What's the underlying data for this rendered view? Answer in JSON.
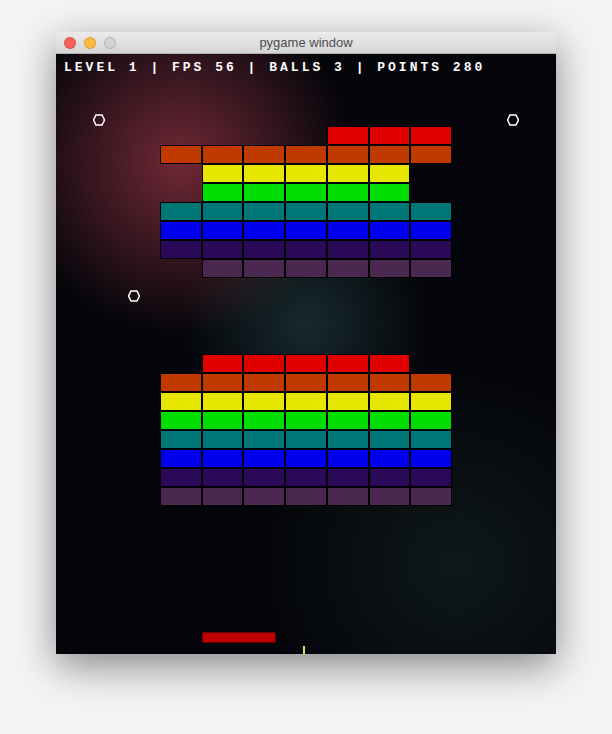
{
  "window": {
    "title": "pygame window",
    "buttons": [
      {
        "name": "close",
        "color": "#fc605c"
      },
      {
        "name": "minimize",
        "color": "#fdbc40"
      },
      {
        "name": "zoom",
        "color": "#d2d2d2"
      }
    ]
  },
  "hud": {
    "text": "LEVEL 1 | FPS 56 | BALLS 3 | POINTS 280"
  },
  "walls": [
    {
      "rows": [
        {
          "color": "#e00000",
          "cells": [
            false,
            false,
            false,
            false,
            true,
            true,
            true
          ]
        },
        {
          "color": "#c03a00",
          "cells": [
            true,
            true,
            true,
            true,
            true,
            true,
            true
          ]
        },
        {
          "color": "#e6e600",
          "cells": [
            false,
            true,
            true,
            true,
            true,
            true,
            false
          ]
        },
        {
          "color": "#00dd00",
          "cells": [
            false,
            true,
            true,
            true,
            true,
            true,
            false
          ]
        },
        {
          "color": "#007777",
          "cells": [
            true,
            true,
            true,
            true,
            true,
            true,
            true
          ]
        },
        {
          "color": "#0000ee",
          "cells": [
            true,
            true,
            true,
            true,
            true,
            true,
            true
          ]
        },
        {
          "color": "#2a0a58",
          "cells": [
            true,
            true,
            true,
            true,
            true,
            true,
            true
          ]
        },
        {
          "color": "#4a2850",
          "cells": [
            false,
            true,
            true,
            true,
            true,
            true,
            true
          ]
        }
      ]
    },
    {
      "rows": [
        {
          "color": "#e00000",
          "cells": [
            false,
            true,
            true,
            true,
            true,
            true,
            false
          ]
        },
        {
          "color": "#c03a00",
          "cells": [
            true,
            true,
            true,
            true,
            true,
            true,
            true
          ]
        },
        {
          "color": "#e6e600",
          "cells": [
            true,
            true,
            true,
            true,
            true,
            true,
            true
          ]
        },
        {
          "color": "#00dd00",
          "cells": [
            true,
            true,
            true,
            true,
            true,
            true,
            true
          ]
        },
        {
          "color": "#007777",
          "cells": [
            true,
            true,
            true,
            true,
            true,
            true,
            true
          ]
        },
        {
          "color": "#0000ee",
          "cells": [
            true,
            true,
            true,
            true,
            true,
            true,
            true
          ]
        },
        {
          "color": "#2a0a58",
          "cells": [
            true,
            true,
            true,
            true,
            true,
            true,
            true
          ]
        },
        {
          "color": "#4a2850",
          "cells": [
            true,
            true,
            true,
            true,
            true,
            true,
            true
          ]
        }
      ]
    }
  ],
  "pickups": [
    {
      "kind": "hexagon"
    },
    {
      "kind": "hexagon"
    },
    {
      "kind": "hexagon"
    }
  ],
  "paddle": {
    "color": "#c00000"
  },
  "ball": {
    "color": "#e0e060"
  }
}
